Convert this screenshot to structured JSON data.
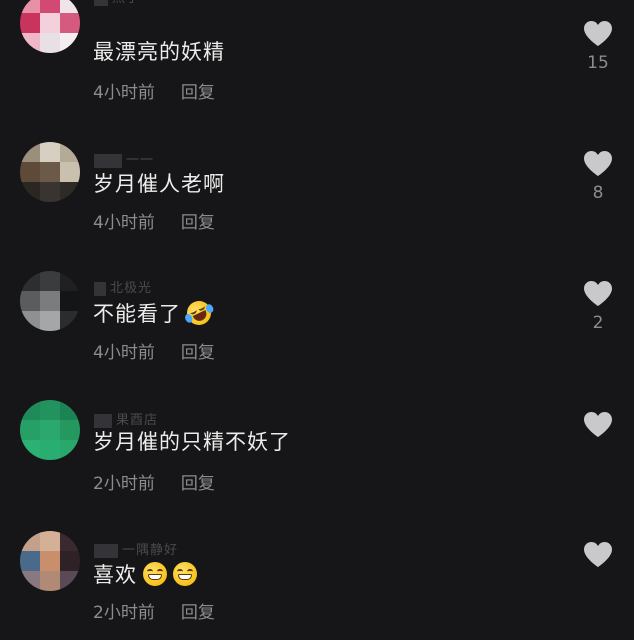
{
  "colors": {
    "background": "#161618",
    "text_primary": "#ececec",
    "text_secondary": "#8c8c90",
    "heart": "#c9c9cc"
  },
  "comments": [
    {
      "username": "燕子",
      "text": "最漂亮的妖精",
      "emojis": [],
      "time": "4小时前",
      "reply_label": "回复",
      "likes": "15",
      "avatar_colors": [
        "#e890a6",
        "#d24a74",
        "#f0e4ea",
        "#c8345e",
        "#f2d0dc",
        "#d55a80",
        "#eeb8c8",
        "#e8e0e4",
        "#f4eef0"
      ]
    },
    {
      "username": "一一",
      "text": "岁月催人老啊",
      "emojis": [],
      "time": "4小时前",
      "reply_label": "回复",
      "likes": "8",
      "avatar_colors": [
        "#9a8e7c",
        "#d6cfc2",
        "#b4aa98",
        "#5e4a38",
        "#6b5a48",
        "#cac0ae",
        "#2a2622",
        "#3a3430",
        "#2e2a26"
      ]
    },
    {
      "username": "北极光",
      "text": "不能看了",
      "emojis": [
        "rolling-laugh-emoji"
      ],
      "time": "4小时前",
      "reply_label": "回复",
      "likes": "2",
      "avatar_colors": [
        "#2c2e30",
        "#3a3c3e",
        "#1e2022",
        "#5a5c5e",
        "#7a7c7e",
        "#141516",
        "#8e9092",
        "#a4a6a8",
        "#2a2c2e"
      ]
    },
    {
      "username": "果酉店",
      "text": "岁月催的只精不妖了",
      "emojis": [],
      "time": "2小时前",
      "reply_label": "回复",
      "likes": "",
      "avatar_colors": [
        "#1f8a5a",
        "#22925e",
        "#1c8454",
        "#27a068",
        "#2aa86e",
        "#24985f",
        "#2bb272",
        "#29ad70",
        "#2aa86c"
      ]
    },
    {
      "username": "一隅静好",
      "text": "喜欢",
      "emojis": [
        "grin-emoji",
        "grin-emoji"
      ],
      "time": "2小时前",
      "reply_label": "回复",
      "likes": "",
      "avatar_colors": [
        "#c4a08a",
        "#d4b096",
        "#3a2a30",
        "#4a6a8c",
        "#c98e6c",
        "#2e2226",
        "#8a7880",
        "#b08a74",
        "#5a4a58"
      ]
    }
  ]
}
